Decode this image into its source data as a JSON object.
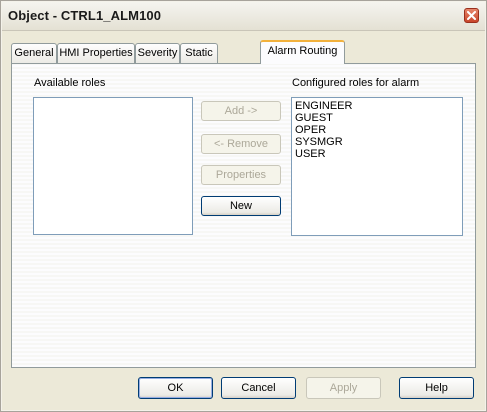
{
  "window": {
    "title": "Object - CTRL1_ALM100",
    "close_icon": "close-icon"
  },
  "tabs": [
    {
      "label": "General",
      "active": false
    },
    {
      "label": "HMI Properties",
      "active": false
    },
    {
      "label": "Severity",
      "active": false
    },
    {
      "label": "Static",
      "active": false
    },
    {
      "label": "Alarm Routing",
      "active": true
    }
  ],
  "alarm_routing": {
    "available_roles_label": "Available roles",
    "available_roles": [],
    "configured_roles_label": "Configured roles for alarm",
    "configured_roles": [
      "ENGINEER",
      "GUEST",
      "OPER",
      "SYSMGR",
      "USER"
    ],
    "buttons": {
      "add": {
        "label": "Add ->",
        "enabled": false
      },
      "remove": {
        "label": "<- Remove",
        "enabled": false
      },
      "properties": {
        "label": "Properties",
        "enabled": false
      },
      "new": {
        "label": "New",
        "enabled": true
      }
    }
  },
  "footer": {
    "ok": {
      "label": "OK",
      "enabled": true
    },
    "cancel": {
      "label": "Cancel",
      "enabled": true
    },
    "apply": {
      "label": "Apply",
      "enabled": false
    },
    "help": {
      "label": "Help",
      "enabled": true
    }
  }
}
